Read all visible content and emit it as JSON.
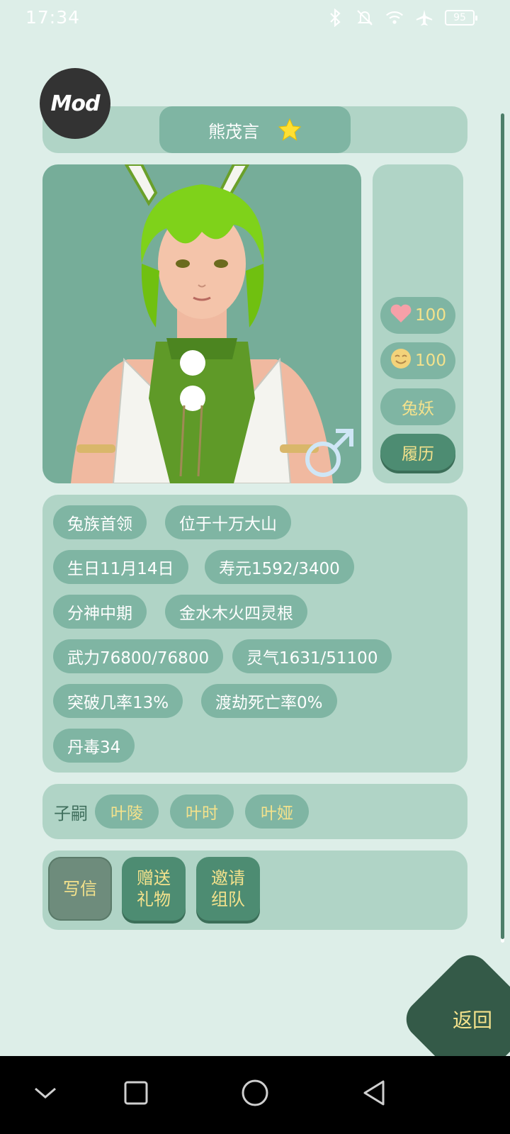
{
  "status_bar": {
    "time": "17:34",
    "battery": "95",
    "icons": [
      "bluetooth-icon",
      "mute-icon",
      "wifi-icon",
      "airplane-icon",
      "battery-icon"
    ]
  },
  "mod_badge": "Mod",
  "character": {
    "name": "熊茂言",
    "favorite_icon": "star-icon",
    "gender_icon": "male-icon",
    "health": "100",
    "mood": "100",
    "race": "兔妖",
    "resume_button": "履历"
  },
  "info_tags": [
    "兔族首领",
    "位于十万大山",
    "生日11月14日",
    "寿元1592/3400",
    "分神中期",
    "金水木火四灵根",
    "武力76800/76800",
    "灵气1631/51100",
    "突破几率13%",
    "渡劫死亡率0%",
    "丹毒34"
  ],
  "children": {
    "label": "子嗣",
    "names": [
      "叶陵",
      "叶时",
      "叶娅"
    ]
  },
  "actions": {
    "write_letter": "写信",
    "send_gift": "赠送\n礼物",
    "invite_team": "邀请\n组队"
  },
  "back_button": "返回",
  "colors": {
    "background": "#ddeee8",
    "panel": "#b0d4c6",
    "pill": "#7fb5a3",
    "accent_text": "#f4e28c",
    "dark_button": "#4d8c72",
    "back_button": "#345a48"
  }
}
